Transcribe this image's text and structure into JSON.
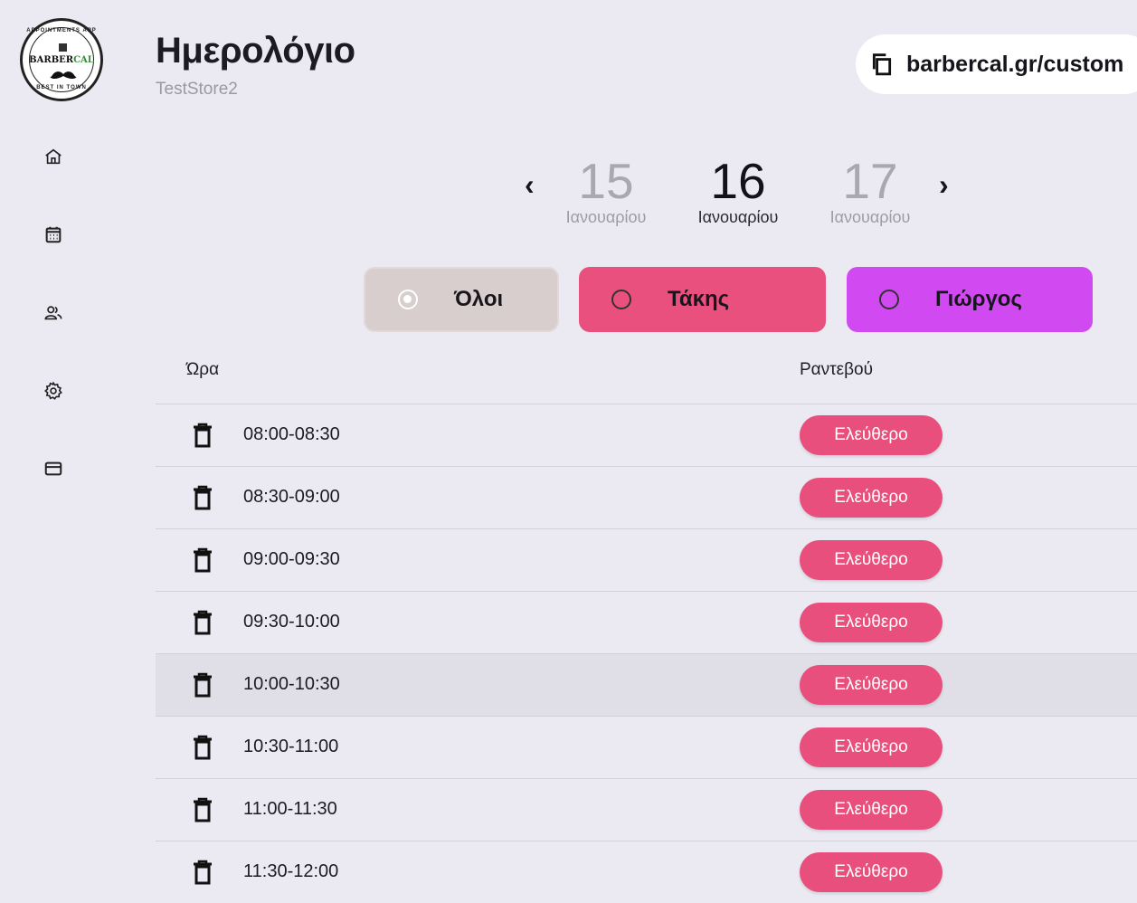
{
  "logo": {
    "top_text": "APPOINTMENTS APP",
    "word_a": "BARBER",
    "word_b": "CAL",
    "bottom_text": "BEST IN TOWN"
  },
  "sidebar": {
    "items": [
      {
        "name": "home",
        "icon": "home-icon"
      },
      {
        "name": "calendar",
        "icon": "calendar-icon"
      },
      {
        "name": "customers",
        "icon": "users-icon"
      },
      {
        "name": "settings",
        "icon": "gear-icon"
      },
      {
        "name": "billing",
        "icon": "credit-card-icon"
      }
    ]
  },
  "header": {
    "title": "Ημερολόγιο",
    "subtitle": "TestStore2",
    "url": "barbercal.gr/custom",
    "copy_icon": "copy-icon"
  },
  "date_nav": {
    "prev": "‹",
    "next": "›",
    "days": [
      {
        "num": "15",
        "month": "Ιανουαρίου",
        "active": false
      },
      {
        "num": "16",
        "month": "Ιανουαρίου",
        "active": true
      },
      {
        "num": "17",
        "month": "Ιανουαρίου",
        "active": false
      }
    ]
  },
  "filters": [
    {
      "label": "Όλοι",
      "selected": true,
      "color": "#d8cecd"
    },
    {
      "label": "Τάκης",
      "selected": false,
      "color": "#ea507d"
    },
    {
      "label": "Γιώργος",
      "selected": false,
      "color": "#d149f0"
    }
  ],
  "table": {
    "col_time": "Ώρα",
    "col_appointment": "Ραντεβού",
    "rows": [
      {
        "time": "08:00-08:30",
        "status": "Ελεύθερο"
      },
      {
        "time": "08:30-09:00",
        "status": "Ελεύθερο"
      },
      {
        "time": "09:00-09:30",
        "status": "Ελεύθερο"
      },
      {
        "time": "09:30-10:00",
        "status": "Ελεύθερο"
      },
      {
        "time": "10:00-10:30",
        "status": "Ελεύθερο",
        "highlighted": true
      },
      {
        "time": "10:30-11:00",
        "status": "Ελεύθερο"
      },
      {
        "time": "11:00-11:30",
        "status": "Ελεύθερο"
      },
      {
        "time": "11:30-12:00",
        "status": "Ελεύθερο"
      }
    ]
  },
  "colors": {
    "background": "#ebeaf3",
    "accent_pink": "#e94f7c",
    "accent_purple": "#d149f0",
    "all_filter": "#d8cecd"
  }
}
